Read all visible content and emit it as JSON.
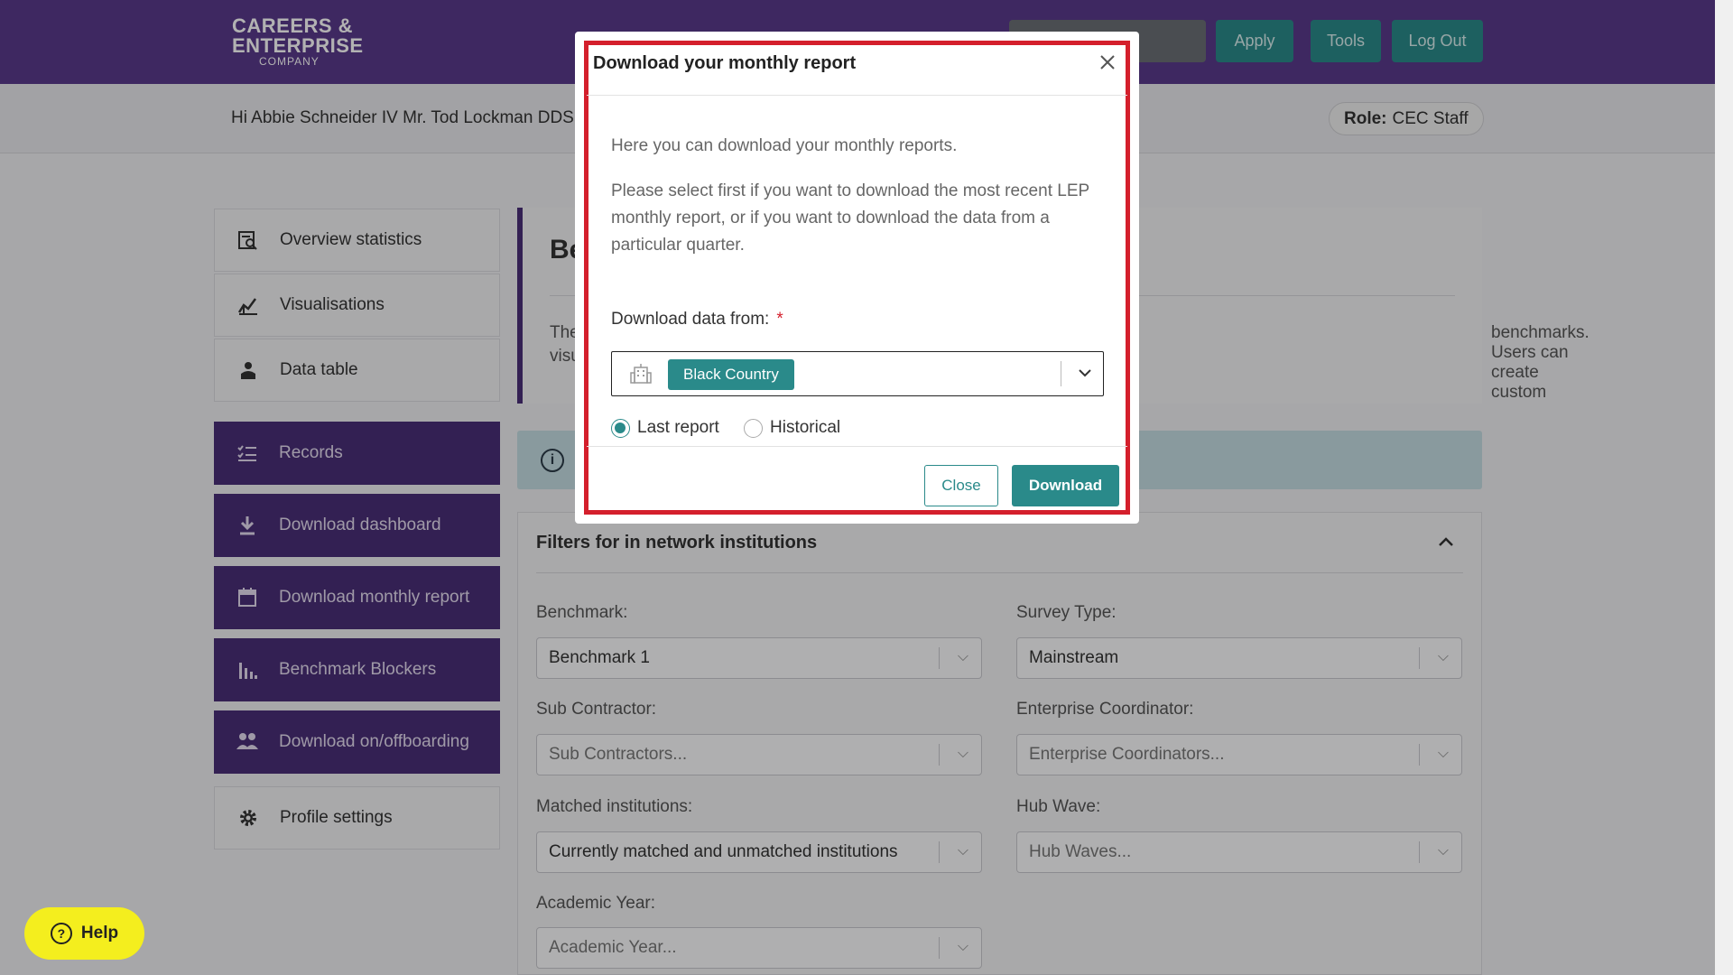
{
  "header": {
    "logo_line1": "CAREERS &",
    "logo_line2": "ENTERPRISE",
    "logo_line3": "COMPANY",
    "buttons": {
      "apply": "Apply",
      "tools": "Tools",
      "logout": "Log Out"
    }
  },
  "subheader": {
    "greeting": "Hi Abbie Schneider IV Mr. Tod Lockman DDS",
    "role_label": "Role:",
    "role_value": "CEC Staff"
  },
  "sidebar": {
    "items": [
      {
        "label": "Overview statistics",
        "icon": "search-report-icon"
      },
      {
        "label": "Visualisations",
        "icon": "chart-icon"
      },
      {
        "label": "Data table",
        "icon": "user-table-icon"
      },
      {
        "label": "Records",
        "icon": "checklist-icon"
      },
      {
        "label": "Download dashboard",
        "icon": "download-icon"
      },
      {
        "label": "Download monthly report",
        "icon": "calendar-icon"
      },
      {
        "label": "Benchmark Blockers",
        "icon": "bar-chart-icon"
      },
      {
        "label": "Download on/offboarding",
        "icon": "people-icon"
      },
      {
        "label": "Profile settings",
        "icon": "gear-icon"
      }
    ]
  },
  "main": {
    "heading_partial": "Be",
    "text_left_partial": "The",
    "text_left_line2_partial": "visu",
    "text_right_partial": "benchmarks. Users can create custom"
  },
  "filters": {
    "title": "Filters for in network institutions",
    "fields": [
      {
        "label": "Benchmark:",
        "value": "Benchmark 1",
        "placeholder": false
      },
      {
        "label": "Survey Type:",
        "value": "Mainstream",
        "placeholder": false
      },
      {
        "label": "Sub Contractor:",
        "value": "Sub Contractors...",
        "placeholder": true
      },
      {
        "label": "Enterprise Coordinator:",
        "value": "Enterprise Coordinators...",
        "placeholder": true
      },
      {
        "label": "Matched institutions:",
        "value": "Currently matched and unmatched institutions",
        "placeholder": false
      },
      {
        "label": "Hub Wave:",
        "value": "Hub Waves...",
        "placeholder": true
      },
      {
        "label": "Academic Year:",
        "value": "Academic Year...",
        "placeholder": true
      }
    ]
  },
  "help": {
    "label": "Help"
  },
  "modal": {
    "title": "Download your monthly report",
    "intro": "Here you can download your monthly reports.",
    "description": "Please select first if you want to download the most recent LEP monthly report, or if you want to download the data from a particular quarter.",
    "field_label": "Download data from:",
    "required_mark": "*",
    "selected_chip": "Black Country",
    "radio_options": [
      {
        "label": "Last report",
        "checked": true
      },
      {
        "label": "Historical",
        "checked": false
      }
    ],
    "close_label": "Close",
    "download_label": "Download"
  },
  "colors": {
    "brand_purple": "#5a3a8c",
    "sidebar_dark": "#4a2f78",
    "teal": "#2a8a8a",
    "highlight_red": "#d41f2c",
    "help_yellow": "#f4ee1e"
  }
}
